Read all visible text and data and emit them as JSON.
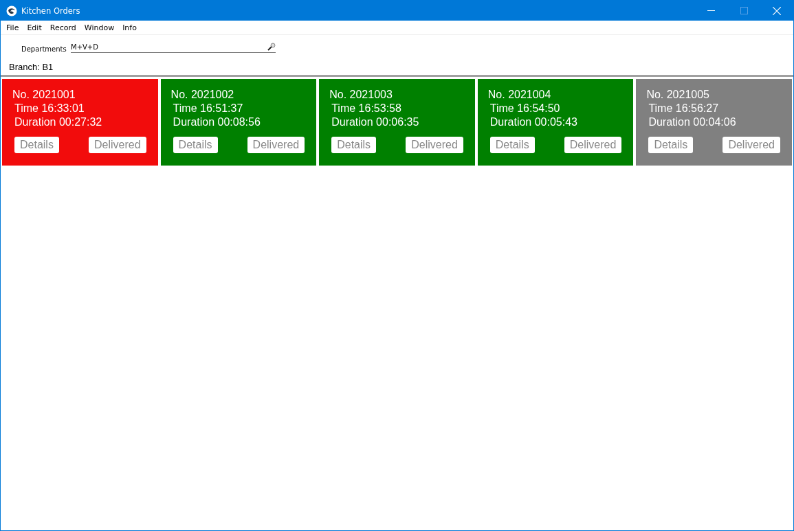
{
  "window": {
    "title": "Kitchen Orders"
  },
  "menu": [
    "File",
    "Edit",
    "Record",
    "Window",
    "Info"
  ],
  "departments": {
    "label": "Departments",
    "value": "M+V+D"
  },
  "branch": "Branch: B1",
  "orders": [
    {
      "number": "No. 2021001",
      "time": "Time 16:33:01",
      "duration": "Duration 00:27:32",
      "color": "#f20c0c",
      "buttons": [
        "Details",
        "Delivered"
      ]
    },
    {
      "number": "No. 2021002",
      "time": "Time 16:51:37",
      "duration": "Duration 00:08:56",
      "color": "#008000",
      "buttons": [
        "Details",
        "Delivered"
      ]
    },
    {
      "number": "No. 2021003",
      "time": "Time 16:53:58",
      "duration": "Duration 00:06:35",
      "color": "#008000",
      "buttons": [
        "Details",
        "Delivered"
      ]
    },
    {
      "number": "No. 2021004",
      "time": "Time 16:54:50",
      "duration": "Duration 00:05:43",
      "color": "#008000",
      "buttons": [
        "Details",
        "Delivered"
      ]
    },
    {
      "number": "No. 2021005",
      "time": "Time 16:56:27",
      "duration": "Duration 00:04:06",
      "color": "#808080",
      "buttons": [
        "Details",
        "Delivered"
      ]
    }
  ]
}
